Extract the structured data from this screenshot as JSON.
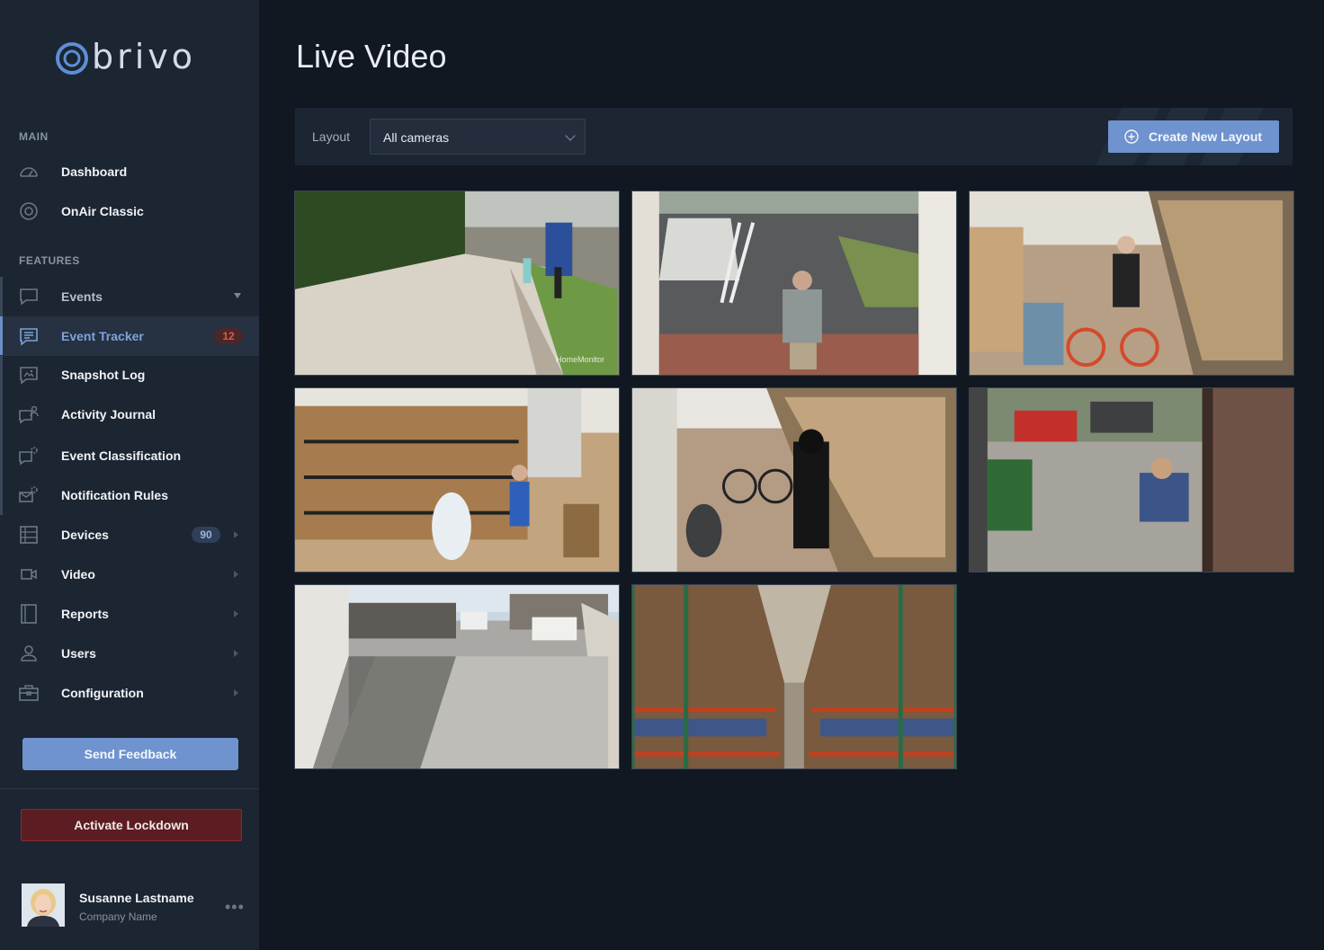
{
  "brand": {
    "name": "brivo"
  },
  "sidebar": {
    "main_label": "MAIN",
    "features_label": "FEATURES",
    "main_items": [
      {
        "label": "Dashboard",
        "icon": "dashboard-gauge-icon"
      },
      {
        "label": "OnAir Classic",
        "icon": "onair-icon"
      }
    ],
    "feature_items": [
      {
        "label": "Events",
        "icon": "chat-bubble-icon",
        "state": "expanded"
      },
      {
        "label": "Event Tracker",
        "icon": "event-tracker-icon",
        "badge": "12",
        "state": "active"
      },
      {
        "label": "Snapshot Log",
        "icon": "snapshot-icon"
      },
      {
        "label": "Activity Journal",
        "icon": "activity-journal-icon"
      },
      {
        "label": "Event Classification",
        "icon": "event-classification-icon"
      },
      {
        "label": "Notification Rules",
        "icon": "notification-rules-icon"
      }
    ],
    "other_items": [
      {
        "label": "Devices",
        "icon": "devices-icon",
        "badge": "90"
      },
      {
        "label": "Video",
        "icon": "video-camera-icon"
      },
      {
        "label": "Reports",
        "icon": "reports-icon"
      },
      {
        "label": "Users",
        "icon": "user-icon"
      },
      {
        "label": "Configuration",
        "icon": "briefcase-icon"
      }
    ],
    "feedback_button": "Send Feedback",
    "lockdown_button": "Activate Lockdown",
    "user": {
      "name": "Susanne Lastname",
      "company": "Company Name",
      "more": "•••"
    }
  },
  "main": {
    "title": "Live Video",
    "toolbar": {
      "layout_label": "Layout",
      "layout_value": "All cameras",
      "create_button": "Create New Layout"
    },
    "cameras": [
      {
        "name": "camera-front-walkway",
        "caption": "HomeMonitor"
      },
      {
        "name": "camera-parking-lot",
        "caption": ""
      },
      {
        "name": "camera-stockroom-bike",
        "caption": ""
      },
      {
        "name": "camera-warehouse-shelves",
        "caption": ""
      },
      {
        "name": "camera-stockroom-costume",
        "caption": ""
      },
      {
        "name": "camera-garage-driveway",
        "caption": ""
      },
      {
        "name": "camera-street-view",
        "caption": ""
      },
      {
        "name": "camera-warehouse-aisle",
        "caption": ""
      }
    ]
  },
  "colors": {
    "accent": "#6f93cf",
    "sidebar_bg": "#1c2532",
    "page_bg": "#111821",
    "danger": "#5c1d22",
    "badge_red": "#e2574c"
  }
}
